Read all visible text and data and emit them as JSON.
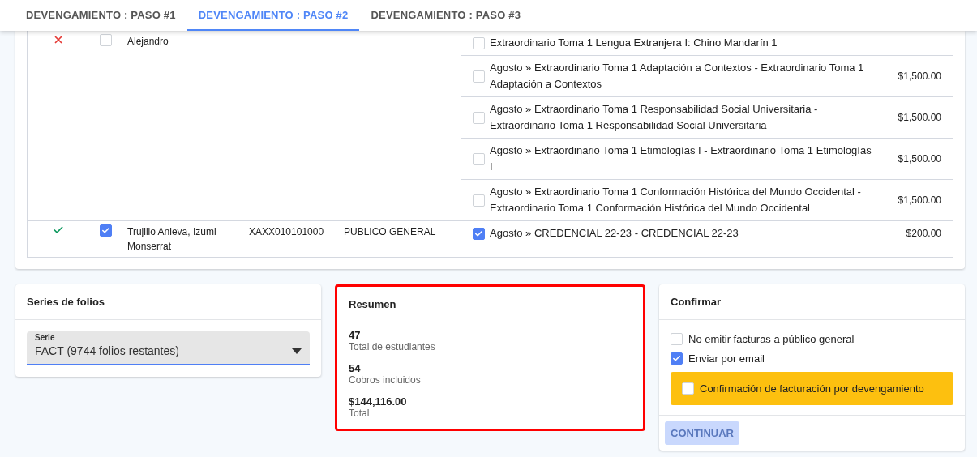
{
  "tabs": [
    {
      "label": "DEVENGAMIENTO : PASO #1",
      "selected": false
    },
    {
      "label": "DEVENGAMIENTO : PASO #2",
      "selected": true
    },
    {
      "label": "DEVENGAMIENTO : PASO #3",
      "selected": false
    }
  ],
  "students": [
    {
      "valid": false,
      "checked": false,
      "name": "Alejandro",
      "charges": [
        {
          "description": "Extraordinario Toma 1 Lengua Extranjera I: Chino Mandarín 1",
          "checked": false
        },
        {
          "description": "Agosto » Extraordinario Toma 1 Adaptación a Contextos - Extraordinario Toma 1 Adaptación a Contextos",
          "amount": "$1,500.00",
          "checked": false
        },
        {
          "description": "Agosto » Extraordinario Toma 1 Responsabilidad Social Universitaria - Extraordinario Toma 1 Responsabilidad Social Universitaria",
          "amount": "$1,500.00",
          "checked": false
        },
        {
          "description": "Agosto » Extraordinario Toma 1 Etimologías I - Extraordinario Toma 1 Etimologías I",
          "amount": "$1,500.00",
          "checked": false
        },
        {
          "description": "Agosto » Extraordinario Toma 1 Conformación Histórica del Mundo Occidental - Extraordinario Toma 1 Conformación Histórica del Mundo Occidental",
          "amount": "$1,500.00",
          "checked": false
        }
      ]
    },
    {
      "valid": true,
      "checked": true,
      "name": "Trujillo Anieva, Izumi Monserrat",
      "rfc": "XAXX010101000",
      "type": "PUBLICO GENERAL",
      "charges": [
        {
          "description": "Agosto » CREDENCIAL 22-23 - CREDENCIAL 22-23",
          "amount": "$200.00",
          "checked": true
        }
      ]
    }
  ],
  "series": {
    "title": "Series de folios",
    "field_label": "Serie",
    "value": "FACT (9744 folios restantes)"
  },
  "summary": {
    "title": "Resumen",
    "highlighted": true,
    "items": [
      {
        "value": "47",
        "label": "Total de estudiantes"
      },
      {
        "value": "54",
        "label": "Cobros incluidos"
      },
      {
        "value": "$144,116.00",
        "label": "Total"
      }
    ]
  },
  "confirm": {
    "title": "Confirmar",
    "options": [
      {
        "label": "No emitir facturas a público general",
        "checked": false
      },
      {
        "label": "Enviar por email",
        "checked": true
      }
    ],
    "confirmation": {
      "label": "Confirmación de facturación por devengamiento",
      "checked": false
    },
    "button": {
      "label": "CONTINUAR",
      "disabled": true
    }
  }
}
